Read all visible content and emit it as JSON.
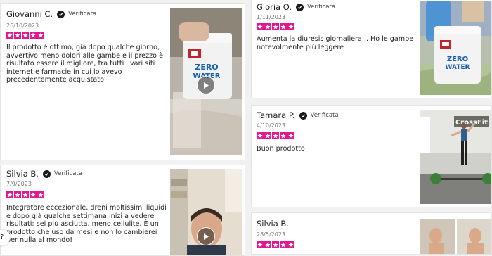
{
  "verified_label": "Verificata",
  "reviews": [
    {
      "author": "Giovanni C.",
      "date": "26/10/2023",
      "text": "Il prodotto è ottimo, già dopo qualche giorno, avvertivo meno dolori alle gambe e il prezzo è risultato essere il migliore, tra tutti i vari siti internet e farmacie in cui lo avevo precedentemente acquistato",
      "rating": 5,
      "media": "video"
    },
    {
      "author": "Gloria O.",
      "date": "1/11/2023",
      "text": "Aumenta la diuresis giornaliera... Ho le gambe notevolmente più leggere",
      "rating": 5,
      "media": "photo"
    },
    {
      "author": "Tamara P.",
      "date": "4/10/2023",
      "text": "Buon prodotto",
      "rating": 5,
      "media": "photo"
    },
    {
      "author": "Silvia B.",
      "date": "7/9/2023",
      "text": "Integratore eccezionale, dreni moltissimi liquidi e dopo già qualche settimana inizi a vedere i risultati: sei più asciutta, meno cellulite. È un prodotto che uso da mesi e non lo cambierei per nulla al mondo!",
      "rating": 5,
      "media": "video"
    },
    {
      "author": "Silvia B.",
      "date": "28/5/2023",
      "text": "",
      "rating": 5,
      "media": "photo"
    }
  ],
  "product_label": {
    "line1": "ZERO",
    "line2": "WATER"
  },
  "gym_sign": "CrossFit",
  "help_button": "?",
  "colors": {
    "star": "#e5178f",
    "verified_badge": "#1a1a1a",
    "page_bg": "#f1f1f1",
    "card_bg": "#ffffff"
  }
}
